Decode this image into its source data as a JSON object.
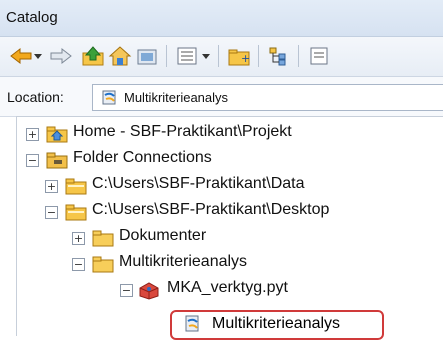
{
  "window": {
    "title": "Catalog"
  },
  "location": {
    "label": "Location:",
    "value": "Multikriterieanalys"
  },
  "tree": [
    {
      "label": "Home - SBF-Praktikant\\Projekt",
      "expander": "+"
    },
    {
      "label": "Folder Connections",
      "expander": "−"
    },
    {
      "label": "C:\\Users\\SBF-Praktikant\\Data",
      "expander": "+"
    },
    {
      "label": "C:\\Users\\SBF-Praktikant\\Desktop",
      "expander": "−"
    },
    {
      "label": "Dokumenter",
      "expander": "+"
    },
    {
      "label": "Multikriterieanalys",
      "expander": "−"
    },
    {
      "label": "MKA_verktyg.pyt",
      "expander": "−"
    },
    {
      "label": "Multikriterieanalys",
      "expander": ""
    }
  ],
  "colors": {
    "highlight": "#d03a3a"
  }
}
